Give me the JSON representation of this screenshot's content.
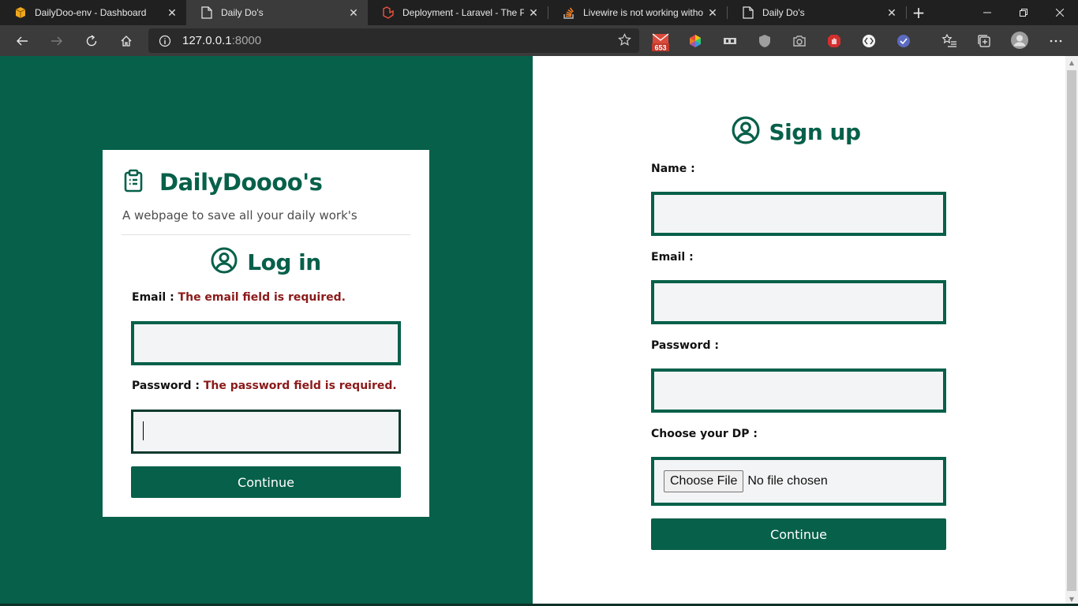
{
  "browser": {
    "tabs": [
      {
        "label": "DailyDoo-env - Dashboard",
        "icon": "package-icon",
        "active": false
      },
      {
        "label": "Daily Do's",
        "icon": "page-icon",
        "active": true
      },
      {
        "label": "Deployment - Laravel - The PH",
        "icon": "laravel-icon",
        "active": false
      },
      {
        "label": "Livewire is not working withou",
        "icon": "stackoverflow-icon",
        "active": false
      },
      {
        "label": "Daily Do's",
        "icon": "page-icon",
        "active": false
      }
    ],
    "close_glyph": "✕",
    "new_tab_glyph": "+",
    "url_host": "127.0.0.1",
    "url_port": ":8000",
    "extension_badge": "653"
  },
  "login_card": {
    "brand_title": "DailyDoooo's",
    "tagline": "A webpage to save all your daily work's",
    "heading": "Log in",
    "email_label": "Email :",
    "email_error": "The email field is required.",
    "email_value": "",
    "password_label": "Password :",
    "password_error": "The password field is required.",
    "password_value": "",
    "submit_label": "Continue"
  },
  "signup": {
    "heading": "Sign up",
    "name_label": "Name :",
    "name_value": "",
    "email_label": "Email :",
    "email_value": "",
    "password_label": "Password :",
    "password_value": "",
    "dp_label": "Choose your DP :",
    "file_button_label": "Choose File",
    "file_status": "No file chosen",
    "submit_label": "Continue"
  },
  "colors": {
    "brand_green": "#07604a",
    "error_red": "#8b1a1a",
    "input_bg": "#f3f4f5"
  }
}
